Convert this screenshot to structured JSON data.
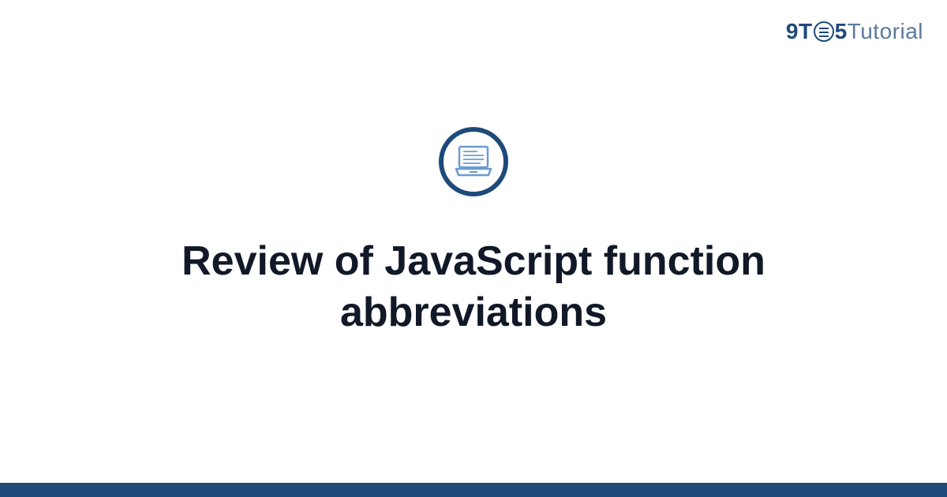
{
  "brand": {
    "nine": "9",
    "t": "T",
    "five": "5",
    "tutorial": "Tutorial"
  },
  "content": {
    "title": "Review of JavaScript function abbreviations"
  },
  "colors": {
    "accent": "#1e4a7a",
    "text": "#111827",
    "brandLight": "#5a7a9a"
  }
}
